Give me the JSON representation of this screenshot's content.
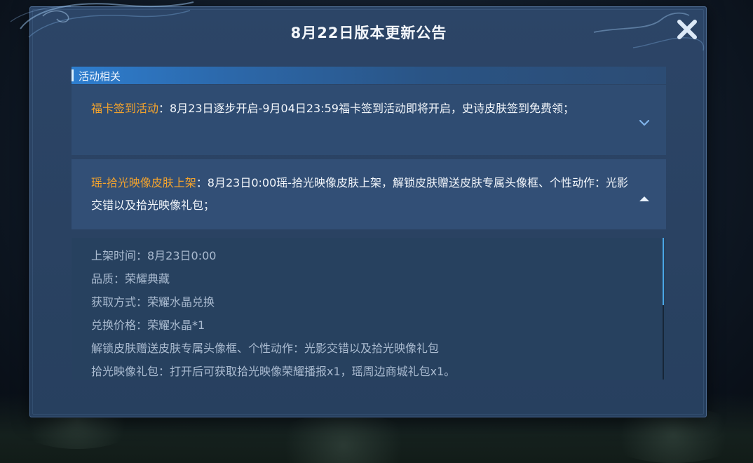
{
  "dialog": {
    "title": "8月22日版本更新公告",
    "close_icon": "close-x-icon"
  },
  "section": {
    "label": "活动相关"
  },
  "items": [
    {
      "highlight": "福卡签到活动",
      "text": "：8月23日逐步开启-9月04日23:59福卡签到活动即将开启，史诗皮肤签到免费领；",
      "expanded": false,
      "chevron_icon": "chevron-down-icon"
    },
    {
      "highlight": "瑶-拾光映像皮肤上架",
      "text": "：8月23日0:00瑶-拾光映像皮肤上架，解锁皮肤赠送皮肤专属头像框、个性动作：光影交错以及拾光映像礼包；",
      "expanded": true,
      "chevron_icon": "chevron-up-icon"
    }
  ],
  "detail_lines": [
    "上架时间：8月23日0:00",
    "品质：荣耀典藏",
    "获取方式：荣耀水晶兑换",
    "兑换价格：荣耀水晶*1",
    "解锁皮肤赠送皮肤专属头像框、个性动作：光影交错以及拾光映像礼包",
    "拾光映像礼包：打开后可获取拾光映像荣耀播报x1，瑶周边商城礼包x1。"
  ],
  "colors": {
    "accent_orange": "#f3a32d",
    "dialog_bg": "#2b4464",
    "section_header": "#2e7ecf",
    "scroll_thumb": "#4aa6e6"
  }
}
